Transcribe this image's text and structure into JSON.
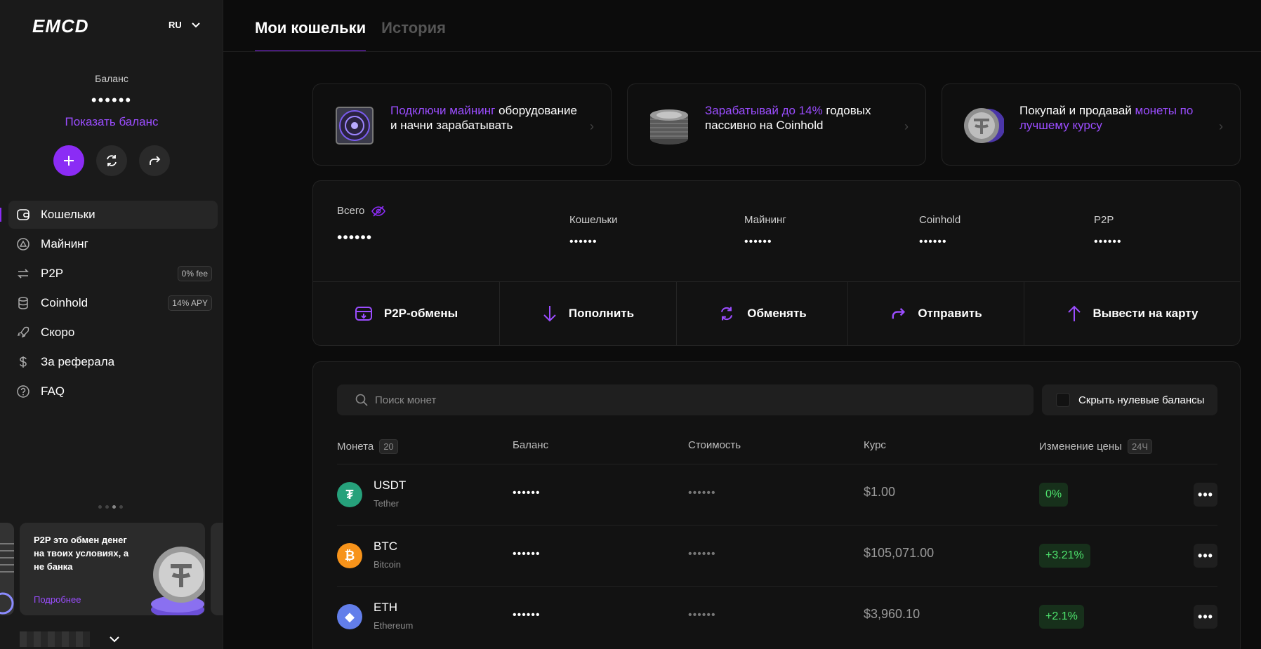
{
  "sidebar": {
    "logo": "EMCD",
    "lang": "RU",
    "balance_label": "Баланс",
    "balance_masked": "••••••",
    "show_balance": "Показать баланс",
    "nav": [
      {
        "label": "Кошельки",
        "icon": "wallet-icon",
        "active": true
      },
      {
        "label": "Майнинг",
        "icon": "mining-icon"
      },
      {
        "label": "P2P",
        "icon": "p2p-arrows-icon",
        "badge": "0% fee"
      },
      {
        "label": "Coinhold",
        "icon": "database-icon",
        "badge": "14% APY"
      },
      {
        "label": "Скоро",
        "icon": "rocket-icon"
      },
      {
        "label": "За реферала",
        "icon": "dollar-icon"
      },
      {
        "label": "FAQ",
        "icon": "question-icon"
      }
    ],
    "promo": {
      "text": "P2P это обмен денег на твоих условиях, а не банка",
      "link": "Подробнее"
    }
  },
  "tabs": [
    "Мои кошельки",
    "История"
  ],
  "promo_tiles": [
    {
      "accent": "Подключи майнинг",
      "rest": " оборудование и начни зарабатывать"
    },
    {
      "accent": "Зарабатывай до 14%",
      "rest": " годовых пассивно на Coinhold"
    },
    {
      "pre": "Покупай и продавай ",
      "accent": "монеты по лучшему курсу"
    }
  ],
  "summary": {
    "total_label": "Всего",
    "total_value": "••••••",
    "columns": [
      {
        "label": "Кошельки",
        "value": "••••••"
      },
      {
        "label": "Майнинг",
        "value": "••••••"
      },
      {
        "label": "Coinhold",
        "value": "••••••"
      },
      {
        "label": "P2P",
        "value": "••••••"
      }
    ],
    "actions": [
      "P2P-обмены",
      "Пополнить",
      "Обменять",
      "Отправить",
      "Вывести на карту"
    ]
  },
  "coins": {
    "search_placeholder": "Поиск монет",
    "hide_zero": "Скрыть нулевые балансы",
    "headers": {
      "coin": "Монета",
      "coin_count": "20",
      "balance": "Баланс",
      "value": "Стоимость",
      "rate": "Курс",
      "change": "Изменение цены",
      "period": "24Ч"
    },
    "rows": [
      {
        "symbol": "USDT",
        "name": "Tether",
        "balance": "••••••",
        "value": "••••••",
        "rate": "$1.00",
        "change": "0%",
        "color": "#26a17b",
        "glyph": "₮"
      },
      {
        "symbol": "BTC",
        "name": "Bitcoin",
        "balance": "••••••",
        "value": "••••••",
        "rate": "$105,071.00",
        "change": "+3.21%",
        "color": "#f7931a",
        "glyph": "₿"
      },
      {
        "symbol": "ETH",
        "name": "Ethereum",
        "balance": "••••••",
        "value": "••••••",
        "rate": "$3,960.10",
        "change": "+2.1%",
        "color": "#627eea",
        "glyph": "◆"
      }
    ]
  },
  "colors": {
    "accent": "#8b2cf5",
    "positive": "#4ee36d"
  }
}
